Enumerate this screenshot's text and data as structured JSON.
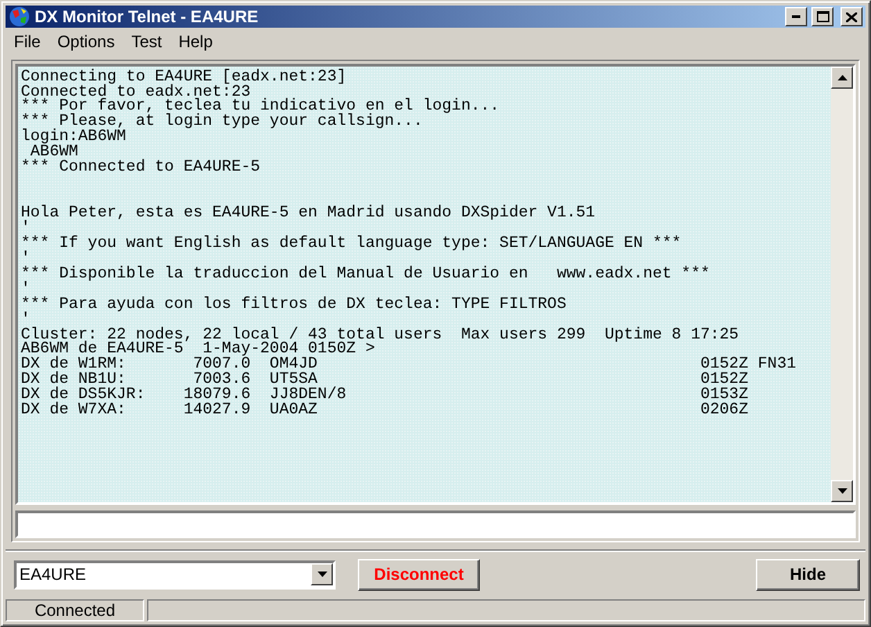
{
  "window": {
    "title": "DX Monitor Telnet - EA4URE"
  },
  "menu": [
    "File",
    "Options",
    "Test",
    "Help"
  ],
  "terminal": {
    "lines": [
      {
        "kind": "text",
        "text": "Connecting to EA4URE [eadx.net:23]"
      },
      {
        "kind": "text",
        "text": "Connected to eadx.net:23"
      },
      {
        "kind": "text",
        "text": "*** Por favor, teclea tu indicativo en el login..."
      },
      {
        "kind": "text",
        "text": "*** Please, at login type your callsign..."
      },
      {
        "kind": "text",
        "text": "login:AB6WM"
      },
      {
        "kind": "text",
        "text": " AB6WM"
      },
      {
        "kind": "text",
        "text": "*** Connected to EA4URE-5"
      },
      {
        "kind": "blank"
      },
      {
        "kind": "blank"
      },
      {
        "kind": "text",
        "text": "Hola Peter, esta es EA4URE-5 en Madrid usando DXSpider V1.51"
      },
      {
        "kind": "text",
        "text": "'"
      },
      {
        "kind": "text",
        "text": "*** If you want English as default language type: SET/LANGUAGE EN ***"
      },
      {
        "kind": "text",
        "text": "'"
      },
      {
        "kind": "text",
        "text": "*** Disponible la traduccion del Manual de Usuario en   www.eadx.net ***"
      },
      {
        "kind": "text",
        "text": "'"
      },
      {
        "kind": "text",
        "text": "*** Para ayuda con los filtros de DX teclea: TYPE FILTROS"
      },
      {
        "kind": "text",
        "text": "'"
      },
      {
        "kind": "text",
        "text": "Cluster: 22 nodes, 22 local / 43 total users  Max users 299  Uptime 8 17:25"
      },
      {
        "kind": "text",
        "text": "AB6WM de EA4URE-5  1-May-2004 0150Z >"
      },
      {
        "kind": "text",
        "text": "DX de W1RM:       7007.0  OM4JD                                        0152Z FN31"
      },
      {
        "kind": "text",
        "text": "DX de NB1U:       7003.6  UT5SA                                        0152Z"
      },
      {
        "kind": "text",
        "text": "DX de DS5KJR:    18079.6  JJ8DEN/8                                     0153Z"
      },
      {
        "kind": "text",
        "text": "DX de W7XA:      14027.9  UA0AZ                                        0206Z"
      }
    ]
  },
  "cluster_select": {
    "value": "EA4URE"
  },
  "buttons": [
    {
      "label": "Disconnect",
      "kind": "danger"
    },
    {
      "label": "Hide",
      "kind": "normal"
    }
  ],
  "status_bar": [
    "Connected"
  ]
}
